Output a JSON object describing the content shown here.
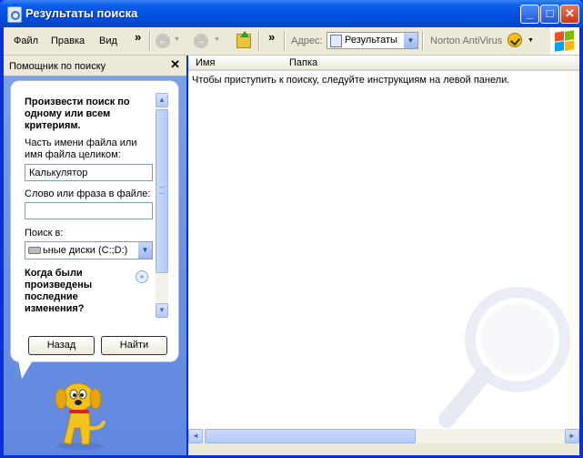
{
  "window": {
    "title": "Результаты поиска",
    "minimize_label": "_",
    "maximize_label": "□",
    "close_label": "✕"
  },
  "menu": {
    "items": [
      "Файл",
      "Правка",
      "Вид"
    ],
    "overflow": "»",
    "toolbar_overflow": "»"
  },
  "toolbar": {
    "back_icon": "back-arrow-icon",
    "forward_icon": "forward-arrow-icon",
    "back_glyph": "←",
    "forward_glyph": "→",
    "dropdown_glyph": "▼",
    "address_label": "Адрес:",
    "address_value": "Результаты",
    "norton_label": "Norton AntiVirus"
  },
  "search_pane": {
    "title": "Помощник по поиску",
    "close_glyph": "✕",
    "heading": "Произвести поиск по одному или всем критериям.",
    "filename_label": "Часть имени файла или имя файла целиком:",
    "filename_value": "Калькулятор",
    "phrase_label": "Слово или фраза в файле:",
    "phrase_value": "",
    "lookin_label": "Поиск в:",
    "lookin_value": "ьные диски (C:;D:)",
    "expand_heading": "Когда были произведены последние изменения?",
    "back_button": "Назад",
    "search_button": "Найти",
    "scroll_up": "▲",
    "scroll_down": "▼",
    "expand_glyph": "»"
  },
  "results": {
    "columns": [
      "Имя",
      "Папка"
    ],
    "message": "Чтобы приступить к поиску, следуйте инструкциям на левой панели.",
    "scroll_left": "◄",
    "scroll_right": "►"
  },
  "colors": {
    "titlebar": "#0a5ee8",
    "left_pane": "#6a8fe3",
    "chrome": "#ece9d8"
  }
}
